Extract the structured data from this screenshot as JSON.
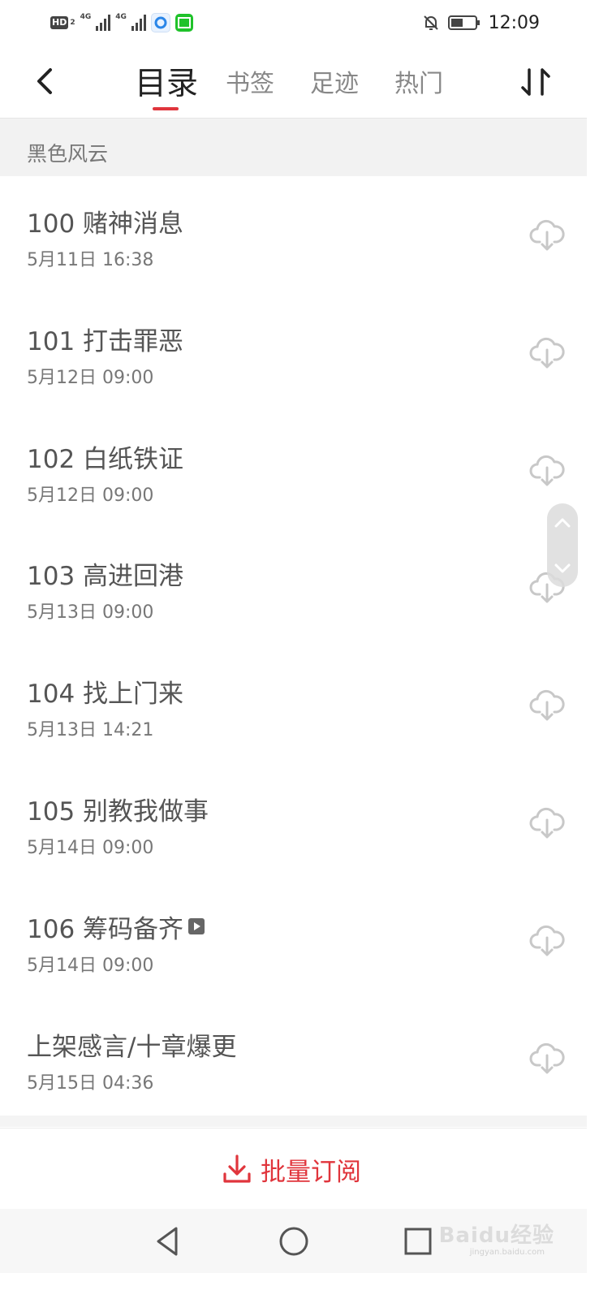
{
  "status_bar": {
    "hd_label": "HD",
    "hd_sub": "2",
    "network_1": "4G",
    "network_2": "4G",
    "time": "12:09"
  },
  "header": {
    "tabs": [
      {
        "label": "目录",
        "active": true
      },
      {
        "label": "书签",
        "active": false
      },
      {
        "label": "足迹",
        "active": false
      },
      {
        "label": "热门",
        "active": false
      }
    ],
    "accent_color": "#e0353c"
  },
  "volume": {
    "title": "黑色风云"
  },
  "chapters": [
    {
      "title": "100 赌神消息",
      "date": "5月11日 16:38"
    },
    {
      "title": "101 打击罪恶",
      "date": "5月12日 09:00"
    },
    {
      "title": "102 白纸铁证",
      "date": "5月12日 09:00"
    },
    {
      "title": "103 高进回港",
      "date": "5月13日 09:00"
    },
    {
      "title": "104 找上门来",
      "date": "5月13日 14:21"
    },
    {
      "title": "105 别教我做事",
      "date": "5月14日 09:00"
    },
    {
      "title": "106 筹码备齐",
      "date": "5月14日 09:00",
      "has_media_badge": true
    },
    {
      "title": "上架感言/十章爆更",
      "date": "5月15日 04:36"
    }
  ],
  "footer": {
    "subscribe_label": "批量订阅"
  },
  "watermark": {
    "text": "Baidu经验",
    "sub": "jingyan.baidu.com"
  }
}
